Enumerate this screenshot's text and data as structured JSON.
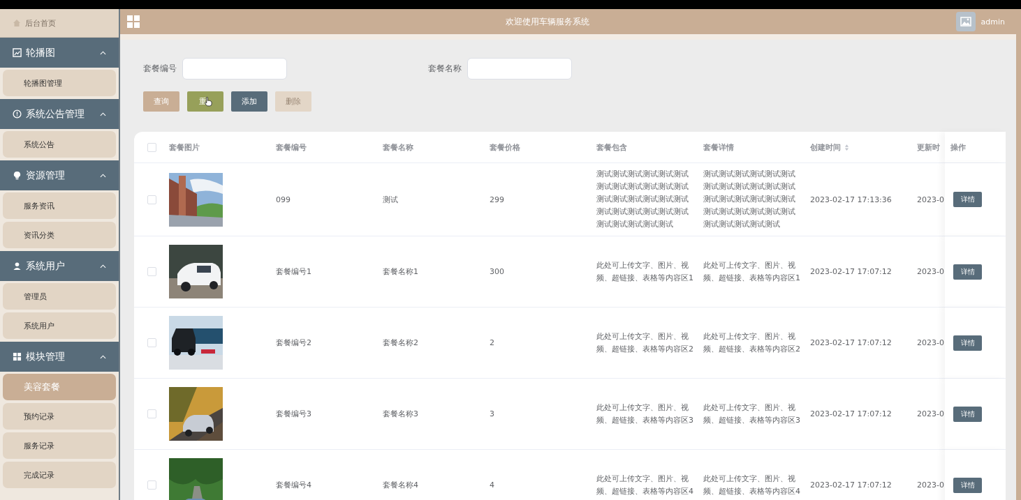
{
  "header": {
    "title": "欢迎使用车辆服务系统",
    "user": "admin"
  },
  "sidebar": {
    "home": {
      "label": "后台首页"
    },
    "groups": [
      {
        "title": "轮播图",
        "expanded": true,
        "items": [
          {
            "label": "轮播图管理",
            "selected": false
          }
        ]
      },
      {
        "title": "系统公告管理",
        "expanded": true,
        "items": [
          {
            "label": "系统公告",
            "selected": false
          }
        ]
      },
      {
        "title": "资源管理",
        "expanded": true,
        "items": [
          {
            "label": "服务资讯",
            "selected": false
          },
          {
            "label": "资讯分类",
            "selected": false
          }
        ]
      },
      {
        "title": "系统用户",
        "expanded": true,
        "items": [
          {
            "label": "管理员",
            "selected": false
          },
          {
            "label": "系统用户",
            "selected": false
          }
        ]
      },
      {
        "title": "模块管理",
        "expanded": true,
        "items": [
          {
            "label": "美容套餐",
            "selected": true
          },
          {
            "label": "预约记录",
            "selected": false
          },
          {
            "label": "服务记录",
            "selected": false
          },
          {
            "label": "完成记录",
            "selected": false
          }
        ]
      }
    ]
  },
  "search": {
    "fields": [
      {
        "label": "套餐编号"
      },
      {
        "label": "套餐名称"
      }
    ]
  },
  "buttons": [
    {
      "label": "查询",
      "kind": "query",
      "disabled": false
    },
    {
      "label": "重",
      "kind": "reset",
      "disabled": false
    },
    {
      "label": "添加",
      "kind": "add",
      "disabled": false
    },
    {
      "label": "删除",
      "kind": "delete",
      "disabled": true
    }
  ],
  "table": {
    "select_all": {
      "checked": false
    },
    "columns": [
      {
        "label": "套餐图片",
        "sortable": false
      },
      {
        "label": "套餐编号",
        "sortable": false
      },
      {
        "label": "套餐名称",
        "sortable": false
      },
      {
        "label": "套餐价格",
        "sortable": false
      },
      {
        "label": "套餐包含",
        "sortable": false
      },
      {
        "label": "套餐详情",
        "sortable": false
      },
      {
        "label": "创建时间",
        "sortable": true
      },
      {
        "label": "更新时",
        "sortable": false
      },
      {
        "label": "操作",
        "sortable": false
      }
    ],
    "rows": [
      {
        "checked": false,
        "code": "099",
        "name": "测试",
        "price": "299",
        "contents": "测试测试测试测试测试测试测试测试测试测试测试测试测试测试测试测试测试测试测试测试测试测试测试测试测试测试测试测试测试",
        "details": "测试测试测试测试测试测试测试测试测试测试测试测试测试测试测试测试测试测试测试测试测试测试测试测试测试测试测试测试测试",
        "created": "2023-02-17 17:13:36",
        "updated": "2023-0",
        "action": "详情"
      },
      {
        "checked": false,
        "code": "套餐编号1",
        "name": "套餐名称1",
        "price": "300",
        "contents": "此处可上传文字、图片、视频、超链接、表格等内容区1",
        "details": "此处可上传文字、图片、视频、超链接、表格等内容区1",
        "created": "2023-02-17 17:07:12",
        "updated": "2023-0",
        "action": "详情"
      },
      {
        "checked": false,
        "code": "套餐编号2",
        "name": "套餐名称2",
        "price": "2",
        "contents": "此处可上传文字、图片、视频、超链接、表格等内容区2",
        "details": "此处可上传文字、图片、视频、超链接、表格等内容区2",
        "created": "2023-02-17 17:07:12",
        "updated": "2023-0",
        "action": "详情"
      },
      {
        "checked": false,
        "code": "套餐编号3",
        "name": "套餐名称3",
        "price": "3",
        "contents": "此处可上传文字、图片、视频、超链接、表格等内容区3",
        "details": "此处可上传文字、图片、视频、超链接、表格等内容区3",
        "created": "2023-02-17 17:07:12",
        "updated": "2023-0",
        "action": "详情"
      },
      {
        "checked": false,
        "code": "套餐编号4",
        "name": "套餐名称4",
        "price": "4",
        "contents": "此处可上传文字、图片、视频、超链接、表格等内容区4",
        "details": "此处可上传文字、图片、视频、超链接、表格等内容区4",
        "created": "2023-02-17 17:07:12",
        "updated": "2023-0",
        "action": "详情"
      }
    ]
  }
}
